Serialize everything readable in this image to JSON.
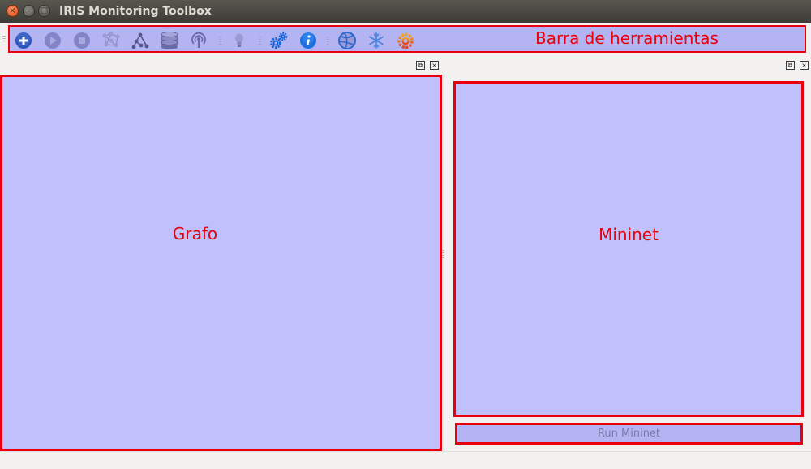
{
  "window": {
    "title": "IRIS Monitoring Toolbox",
    "controls": {
      "close": "×",
      "minimize": "–",
      "maximize": "□"
    }
  },
  "toolbar": {
    "label": "Barra de herramientas",
    "icons": [
      {
        "name": "add-icon",
        "color": "#2d55b8"
      },
      {
        "name": "play-icon",
        "color": "#7d7dc4"
      },
      {
        "name": "stop-icon",
        "color": "#7d7dc4"
      },
      {
        "name": "topology-icon",
        "color": "#8a8ac8"
      },
      {
        "name": "graph-nodes-icon",
        "color": "#55558a"
      },
      {
        "name": "database-icon",
        "color": "#6a6aa8"
      },
      {
        "name": "broadcast-icon",
        "color": "#6a6aa8"
      },
      {
        "name": "lightbulb-icon",
        "color": "#8a8ac8"
      },
      {
        "name": "settings-gears-icon",
        "color": "#1565d8"
      },
      {
        "name": "info-icon",
        "color": "#1d6fe0"
      },
      {
        "name": "globe-icon",
        "color": "#2d68d0"
      },
      {
        "name": "snowflake-icon",
        "color": "#4a84e0"
      },
      {
        "name": "grafana-icon",
        "color": "#e05a1c"
      }
    ]
  },
  "dock": {
    "float_symbol": "⧉",
    "close_symbol": "×"
  },
  "panels": {
    "graph": {
      "label": "Grafo"
    },
    "mininet": {
      "label": "Mininet"
    }
  },
  "run_button": {
    "label": "Run Mininet"
  },
  "colors": {
    "panel_fill": "#c0c0fc",
    "highlight_border": "#e8000c",
    "toolbar_fill": "#b4b4f2"
  }
}
